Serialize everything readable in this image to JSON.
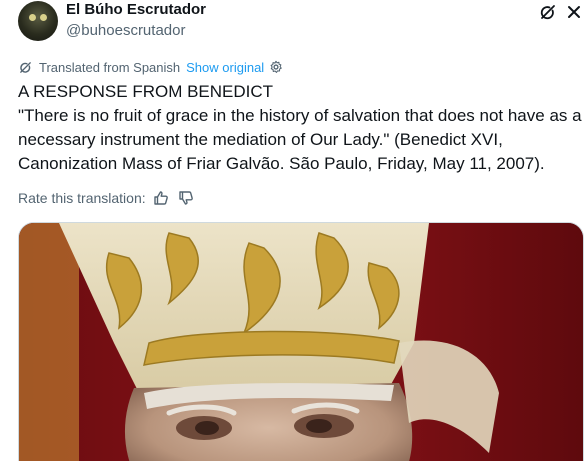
{
  "author": {
    "name": "El Búho Escrutador",
    "handle": "@buhoescrutador"
  },
  "icons": {
    "grok": "grok-icon",
    "more": "more-icon",
    "translate": "translate-icon",
    "gear": "gear-icon",
    "like": "thumbs-up-icon",
    "dislike": "thumbs-down-icon"
  },
  "translation": {
    "label": "Translated from Spanish",
    "show_original": "Show original"
  },
  "post": {
    "text": "A RESPONSE FROM BENEDICT\n\"There is no fruit of grace in the history of salvation that does not have as a necessary instrument the mediation of Our Lady.\" (Benedict XVI, Canonization Mass of Friar Galvão. São Paulo, Friday, May 11, 2007)."
  },
  "rating": {
    "label": "Rate this translation:"
  },
  "colors": {
    "link": "#1d9bf0",
    "secondary_text": "#536471",
    "mitre_gold": "#c9a13a",
    "background_red": "#7a0d12"
  }
}
